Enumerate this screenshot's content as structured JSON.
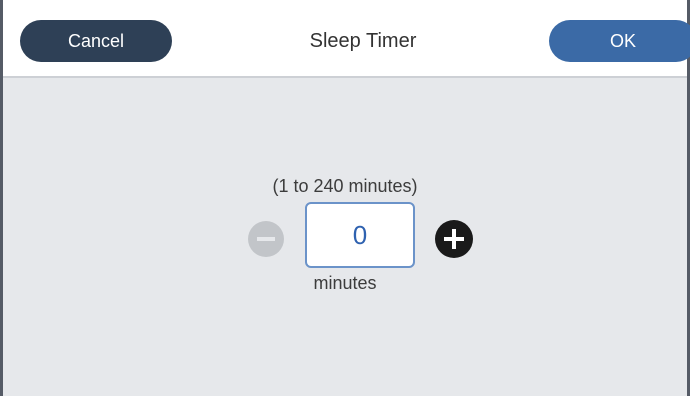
{
  "header": {
    "cancel_label": "Cancel",
    "title": "Sleep Timer",
    "ok_label": "OK"
  },
  "timer": {
    "range_text": "(1 to 240 minutes)",
    "value": "0",
    "unit": "minutes",
    "decrease_enabled": false
  },
  "colors": {
    "cancel_button": "#2e4056",
    "ok_button": "#3b6aa6",
    "value_text": "#2f62b0",
    "background": "#e6e8eb"
  }
}
